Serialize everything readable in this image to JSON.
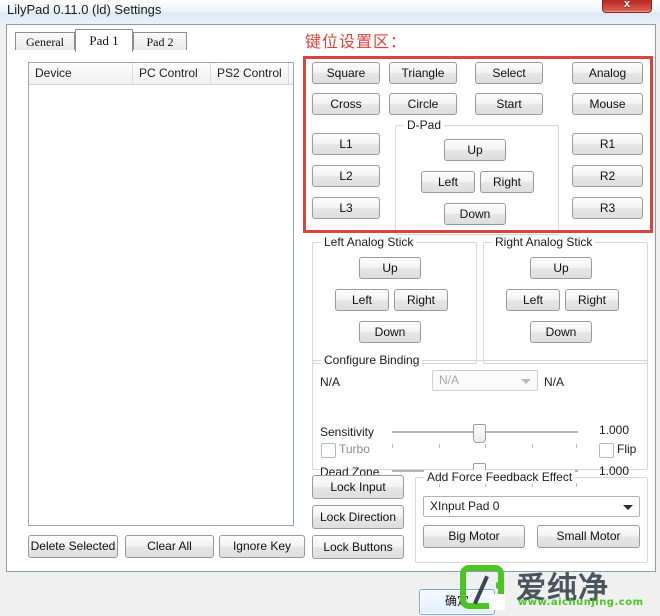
{
  "window": {
    "title": "LilyPad 0.11.0 (ld) Settings",
    "close_label": "x",
    "close_icon": "close-icon"
  },
  "tabs": [
    {
      "label": "General",
      "active": false
    },
    {
      "label": "Pad 1",
      "active": true
    },
    {
      "label": "Pad 2",
      "active": false
    }
  ],
  "device_list": {
    "columns": [
      "Device",
      "PC Control",
      "PS2 Control",
      ""
    ],
    "rows": []
  },
  "annotation": {
    "text": "键位设置区：",
    "color": "#d9453d"
  },
  "pad_buttons": {
    "row1": [
      "Square",
      "Triangle",
      "Select",
      "Analog"
    ],
    "row2": [
      "Cross",
      "Circle",
      "Start",
      "Mouse"
    ],
    "left_column": [
      "L1",
      "L2",
      "L3"
    ],
    "right_column": [
      "R1",
      "R2",
      "R3"
    ]
  },
  "dpad": {
    "title": "D-Pad",
    "up": "Up",
    "left": "Left",
    "right": "Right",
    "down": "Down"
  },
  "left_stick": {
    "title": "Left Analog Stick",
    "up": "Up",
    "left": "Left",
    "right": "Right",
    "down": "Down"
  },
  "right_stick": {
    "title": "Right Analog Stick",
    "up": "Up",
    "left": "Left",
    "right": "Right",
    "down": "Down"
  },
  "configure_binding": {
    "title": "Configure Binding",
    "left_label": "N/A",
    "combo_value": "N/A",
    "right_label": "N/A",
    "sensitivity_label": "Sensitivity",
    "sensitivity_value": "1.000",
    "turbo_label": "Turbo",
    "flip_label": "Flip",
    "deadzone_label": "Dead Zone",
    "deadzone_value": "1.000"
  },
  "list_actions": {
    "delete_selected": "Delete Selected",
    "clear_all": "Clear All",
    "ignore_key": "Ignore Key"
  },
  "lock_actions": {
    "lock_input": "Lock Input",
    "lock_direction": "Lock Direction",
    "lock_buttons": "Lock Buttons"
  },
  "force_feedback": {
    "title": "Add Force Feedback Effect",
    "device": "XInput Pad 0",
    "big_motor": "Big Motor",
    "small_motor": "Small Motor"
  },
  "footer": {
    "ok_label": "确定"
  },
  "watermark": {
    "brand": "爱纯净",
    "url": "www.aichunjing.com",
    "brand_color": "#4cc425"
  }
}
